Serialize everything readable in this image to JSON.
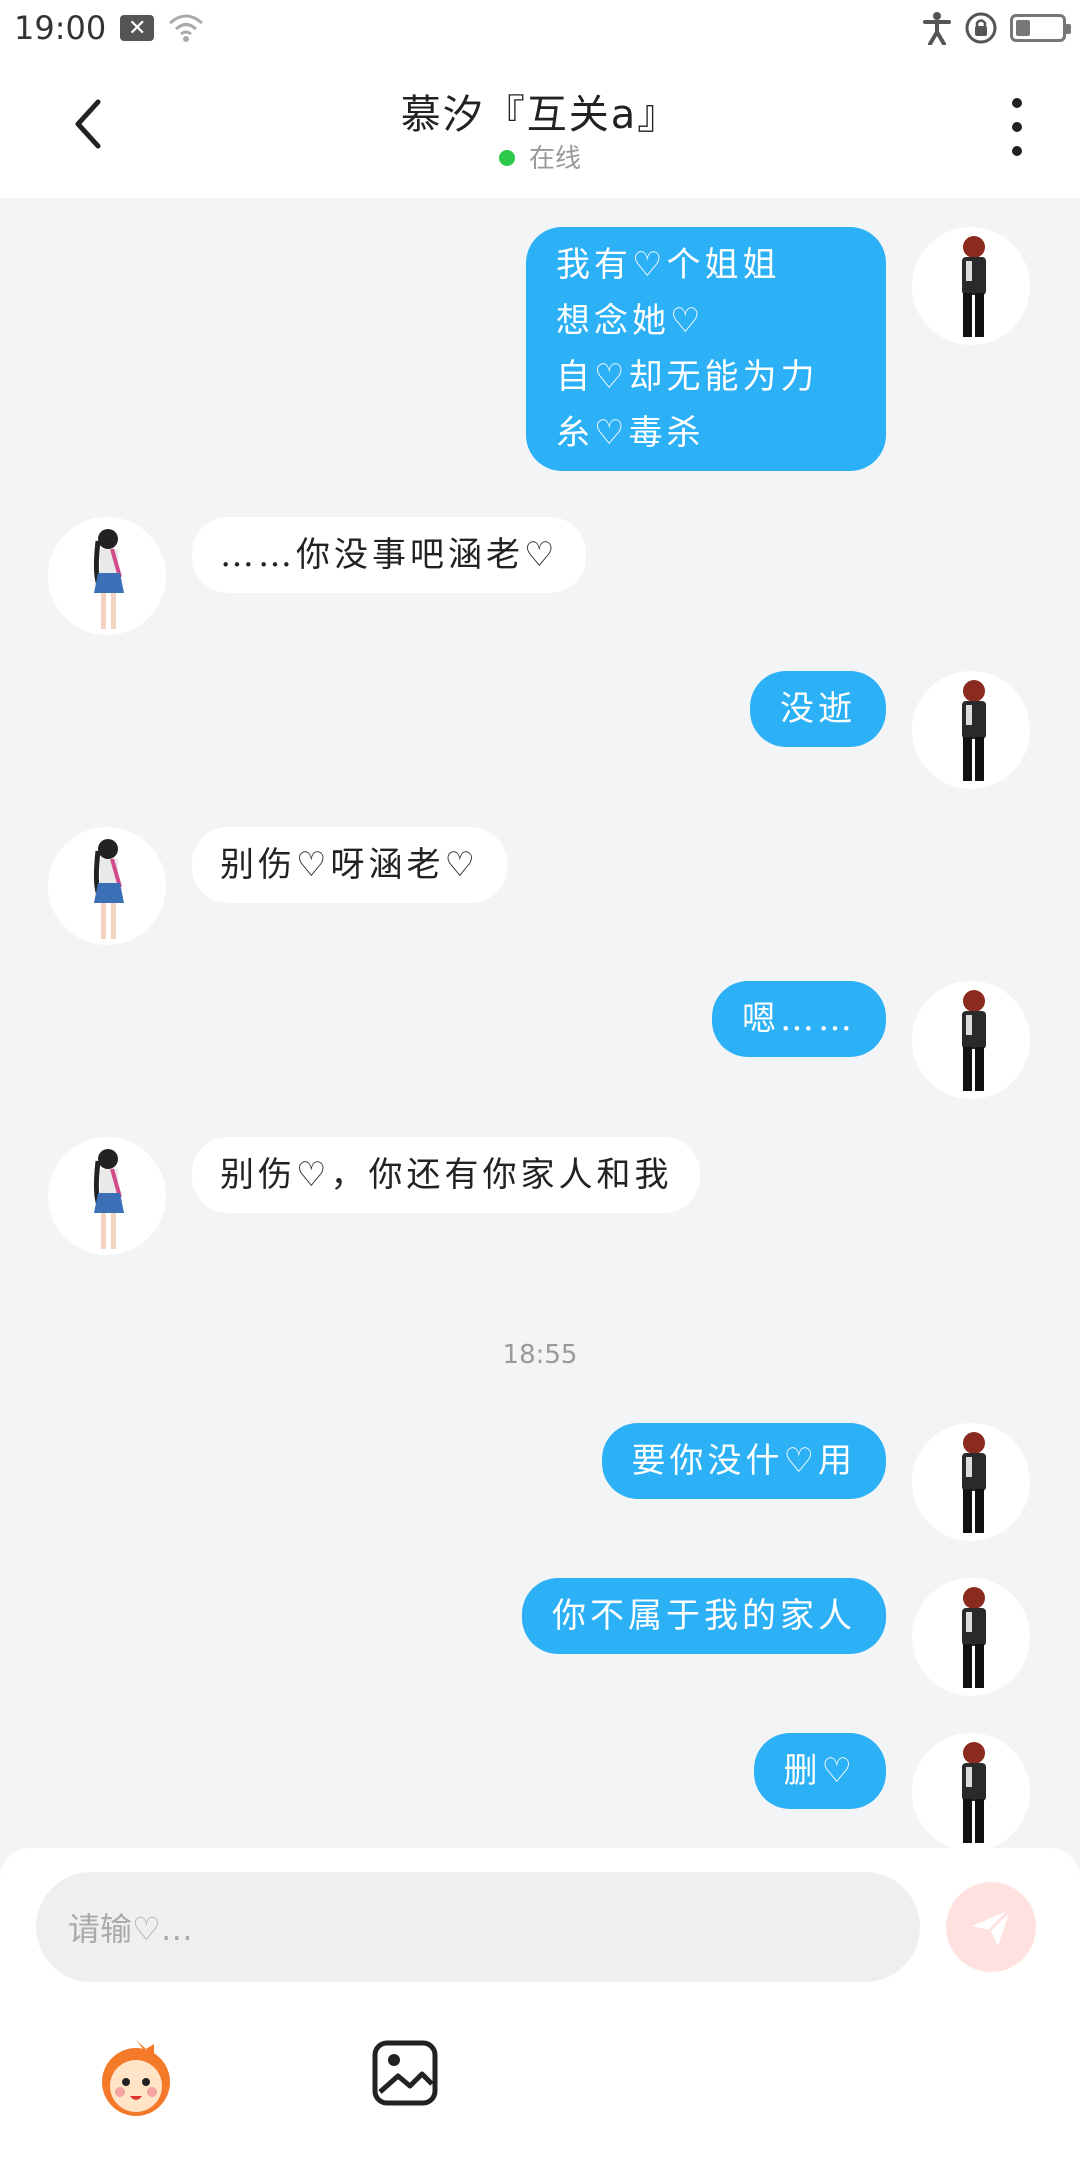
{
  "status_bar": {
    "time": "19:00"
  },
  "header": {
    "title": "慕汐『互关a』",
    "status": "在线"
  },
  "messages": [
    {
      "side": "out",
      "lines": [
        "我有♡个姐姐",
        "想念她♡",
        "自♡却无能为力",
        "糸♡毒杀"
      ]
    },
    {
      "side": "in",
      "lines": [
        "……你没事吧涵老♡"
      ]
    },
    {
      "side": "out",
      "lines": [
        "没逝"
      ]
    },
    {
      "side": "in",
      "lines": [
        "别伤♡呀涵老♡"
      ]
    },
    {
      "side": "out",
      "lines": [
        "嗯……"
      ]
    },
    {
      "side": "in",
      "lines": [
        "别伤♡，你还有你家人和我"
      ]
    },
    {
      "side": "out",
      "lines": [
        "要你没什♡用"
      ]
    },
    {
      "side": "out",
      "lines": [
        "你不属于我的家人"
      ]
    },
    {
      "side": "out",
      "lines": [
        "删♡"
      ]
    }
  ],
  "timestamp": "18:55",
  "input": {
    "placeholder": "请输♡…"
  },
  "icons": {
    "back": "chevron-left-icon",
    "more": "more-vertical-icon",
    "send": "send-icon",
    "emoji": "emoji-icon",
    "image": "image-icon"
  },
  "colors": {
    "outgoing_bubble": "#2cb0f6",
    "online": "#2bc84a",
    "send_button": "#ffe2df"
  }
}
